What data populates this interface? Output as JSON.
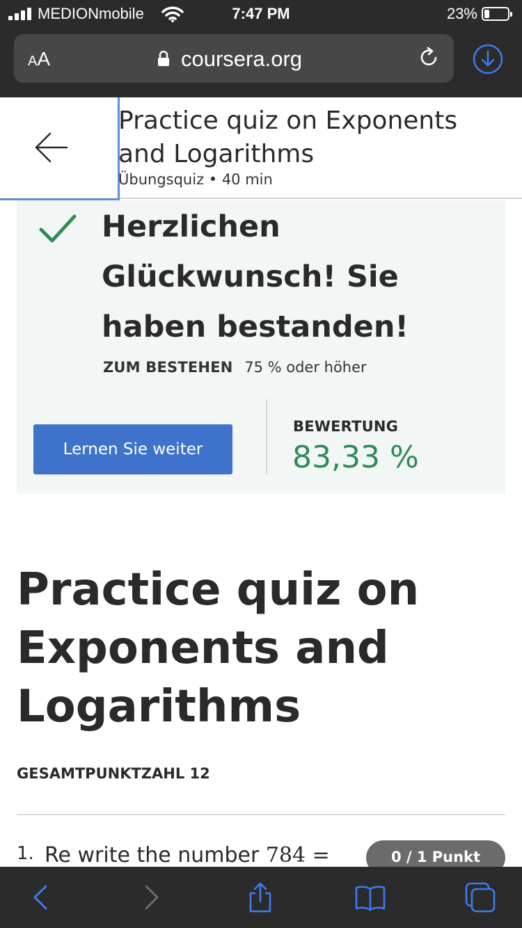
{
  "status_bar": {
    "carrier": "MEDIONmobile",
    "time": "7:47 PM",
    "battery_percent": "23%",
    "battery_level": 0.23
  },
  "browser": {
    "text_size_label_small": "A",
    "text_size_label_large": "A",
    "domain": "coursera.org"
  },
  "header": {
    "title": "Practice quiz on Exponents and Logarithms",
    "subtitle": "Übungsquiz • 40 min"
  },
  "result": {
    "message": "Herzlichen Glückwunsch! Sie haben bestanden!",
    "pass_label": "ZUM BESTEHEN",
    "pass_value": "75 % oder höher",
    "continue_button": "Lernen Sie weiter",
    "grade_label": "BEWERTUNG",
    "grade_value": "83,33 %",
    "grade_color": "#2e8b57"
  },
  "quiz": {
    "title": "Practice quiz on Exponents and Logarithms",
    "total_points": "GESAMTPUNKTZAHL 12",
    "questions": [
      {
        "number": "1.",
        "text": "Re write the number ",
        "math": "784 =",
        "points": "0 / 1 Punkt"
      }
    ]
  },
  "colors": {
    "accent": "#3f73cb",
    "chrome": "#2b2b2b",
    "toolbar_icons": "#3d7cf0",
    "success": "#2e8b57",
    "card_bg": "#f2f7f5"
  },
  "icons": {
    "signal": "cellular-signal-icon",
    "wifi": "wifi-icon",
    "battery": "battery-icon",
    "lock": "lock-icon",
    "reload": "reload-icon",
    "download": "download-icon",
    "back": "arrow-left-icon",
    "check": "checkmark-icon",
    "toolbar": [
      "chevron-left-icon",
      "chevron-right-icon",
      "share-icon",
      "book-icon",
      "tabs-icon"
    ]
  }
}
